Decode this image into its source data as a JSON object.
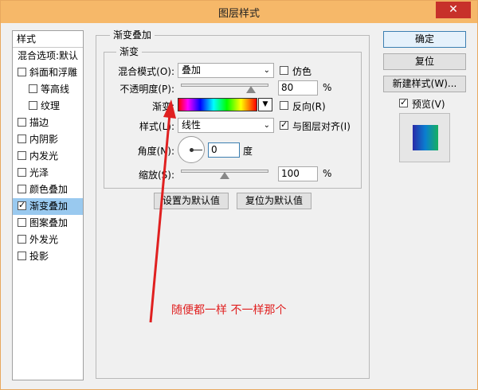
{
  "window": {
    "title": "图层样式",
    "close_symbol": "✕"
  },
  "sidebar": {
    "header": "样式",
    "items": [
      {
        "label": "混合选项:默认",
        "has_checkbox": false,
        "checked": false,
        "indent": false,
        "selected": false
      },
      {
        "label": "斜面和浮雕",
        "has_checkbox": true,
        "checked": false,
        "indent": false,
        "selected": false
      },
      {
        "label": "等高线",
        "has_checkbox": true,
        "checked": false,
        "indent": true,
        "selected": false
      },
      {
        "label": "纹理",
        "has_checkbox": true,
        "checked": false,
        "indent": true,
        "selected": false
      },
      {
        "label": "描边",
        "has_checkbox": true,
        "checked": false,
        "indent": false,
        "selected": false
      },
      {
        "label": "内阴影",
        "has_checkbox": true,
        "checked": false,
        "indent": false,
        "selected": false
      },
      {
        "label": "内发光",
        "has_checkbox": true,
        "checked": false,
        "indent": false,
        "selected": false
      },
      {
        "label": "光泽",
        "has_checkbox": true,
        "checked": false,
        "indent": false,
        "selected": false
      },
      {
        "label": "颜色叠加",
        "has_checkbox": true,
        "checked": false,
        "indent": false,
        "selected": false
      },
      {
        "label": "渐变叠加",
        "has_checkbox": true,
        "checked": true,
        "indent": false,
        "selected": true
      },
      {
        "label": "图案叠加",
        "has_checkbox": true,
        "checked": false,
        "indent": false,
        "selected": false
      },
      {
        "label": "外发光",
        "has_checkbox": true,
        "checked": false,
        "indent": false,
        "selected": false
      },
      {
        "label": "投影",
        "has_checkbox": true,
        "checked": false,
        "indent": false,
        "selected": false
      }
    ]
  },
  "panel": {
    "group_title": "渐变叠加",
    "subgroup_title": "渐变",
    "blend_mode": {
      "label": "混合模式(O):",
      "value": "叠加"
    },
    "dither": {
      "label": "仿色",
      "checked": false
    },
    "opacity": {
      "label": "不透明度(P):",
      "value": "80",
      "unit": "%",
      "fraction": 0.8
    },
    "gradient": {
      "label": "渐变:",
      "drop_symbol": "▼"
    },
    "reverse": {
      "label": "反向(R)",
      "checked": false
    },
    "style": {
      "label": "样式(L):",
      "value": "线性"
    },
    "align_with_layer": {
      "label": "与图层对齐(I)",
      "checked": true
    },
    "angle": {
      "label": "角度(N):",
      "value": "0",
      "unit": "度"
    },
    "scale": {
      "label": "缩放(S):",
      "value": "100",
      "unit": "%",
      "fraction": 0.5
    },
    "buttons": {
      "set_default": "设置为默认值",
      "reset_default": "复位为默认值"
    }
  },
  "right": {
    "ok": "确定",
    "reset": "复位",
    "new_style": "新建样式(W)...",
    "preview": {
      "label": "预览(V)",
      "checked": true
    }
  },
  "annotation": {
    "text": "随便都一样 不一样那个",
    "color": "#e02020"
  },
  "icons": {
    "select_arrow": "⌄",
    "close": "close-icon",
    "angle": "angle-dial-icon"
  }
}
